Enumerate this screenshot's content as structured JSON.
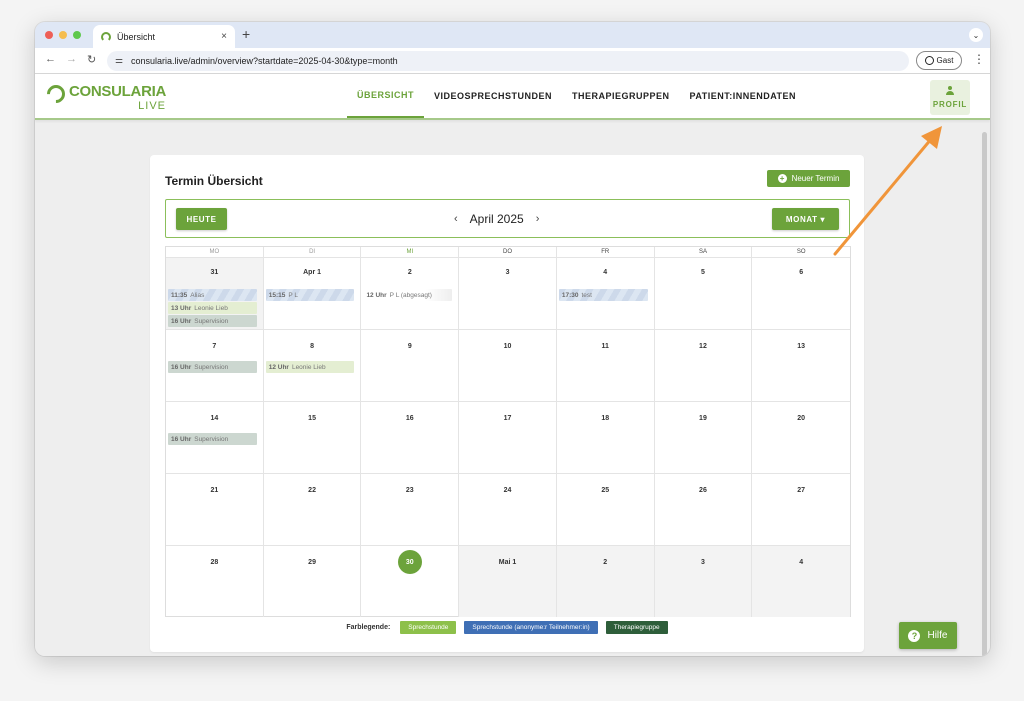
{
  "browser": {
    "tab_title": "Übersicht",
    "close_glyph": "×",
    "newtab_glyph": "+",
    "url": "consularia.live/admin/overview?startdate=2025-04-30&type=month",
    "profile_label": "Gast",
    "back_glyph": "←",
    "forward_glyph": "→",
    "reload_glyph": "↻",
    "menu_glyph": "⋮",
    "chevron_glyph": "⌄",
    "tune_glyph": "⚌"
  },
  "header": {
    "logo_word": "CONSULARIA",
    "logo_sub": "LIVE",
    "menu": [
      {
        "label": "ÜBERSICHT"
      },
      {
        "label": "VIDEOSPRECHSTUNDEN"
      },
      {
        "label": "THERAPIEGRUPPEN"
      },
      {
        "label": "PATIENT:INNENDATEN"
      }
    ],
    "profile_label": "PROFIL"
  },
  "card": {
    "title": "Termin Übersicht",
    "new_button": "Neuer Termin",
    "plus_glyph": "+",
    "today_button": "HEUTE",
    "month_title": "April 2025",
    "view_button": "MONAT  ▾",
    "prev_glyph": "‹",
    "next_glyph": "›"
  },
  "calendar": {
    "weekdays": [
      "MO",
      "DI",
      "MI",
      "DO",
      "FR",
      "SA",
      "SO"
    ],
    "weeks": [
      [
        {
          "num": "31",
          "events": [
            {
              "time": "11:35",
              "text": "Alias",
              "style": "blue"
            },
            {
              "time": "13 Uhr",
              "text": "Leonie Lieb",
              "style": "green"
            },
            {
              "time": "16 Uhr",
              "text": "Supervision",
              "style": "dark"
            }
          ]
        },
        {
          "num": "Apr 1",
          "events": [
            {
              "time": "15:15",
              "text": "P L",
              "style": "blue"
            }
          ]
        },
        {
          "num": "2",
          "events": [
            {
              "time": "12 Uhr",
              "text": "P L (abgesagt)",
              "style": "plain"
            }
          ]
        },
        {
          "num": "3",
          "events": []
        },
        {
          "num": "4",
          "events": [
            {
              "time": "17:30",
              "text": "test",
              "style": "blue"
            }
          ]
        },
        {
          "num": "5",
          "events": []
        },
        {
          "num": "6",
          "events": []
        }
      ],
      [
        {
          "num": "7",
          "events": [
            {
              "time": "16 Uhr",
              "text": "Supervision",
              "style": "dark"
            }
          ]
        },
        {
          "num": "8",
          "events": [
            {
              "time": "12 Uhr",
              "text": "Leonie Lieb",
              "style": "green"
            }
          ]
        },
        {
          "num": "9",
          "events": []
        },
        {
          "num": "10",
          "events": []
        },
        {
          "num": "11",
          "events": []
        },
        {
          "num": "12",
          "events": []
        },
        {
          "num": "13",
          "events": []
        }
      ],
      [
        {
          "num": "14",
          "events": [
            {
              "time": "16 Uhr",
              "text": "Supervision",
              "style": "dark"
            }
          ]
        },
        {
          "num": "15",
          "events": []
        },
        {
          "num": "16",
          "events": []
        },
        {
          "num": "17",
          "events": []
        },
        {
          "num": "18",
          "events": []
        },
        {
          "num": "19",
          "events": []
        },
        {
          "num": "20",
          "events": []
        }
      ],
      [
        {
          "num": "21",
          "events": []
        },
        {
          "num": "22",
          "events": []
        },
        {
          "num": "23",
          "events": []
        },
        {
          "num": "24",
          "events": []
        },
        {
          "num": "25",
          "events": []
        },
        {
          "num": "26",
          "events": []
        },
        {
          "num": "27",
          "events": []
        }
      ],
      [
        {
          "num": "28",
          "events": []
        },
        {
          "num": "29",
          "events": []
        },
        {
          "num": "30",
          "events": [],
          "today": true
        },
        {
          "num": "Mai 1",
          "events": [],
          "other": true
        },
        {
          "num": "2",
          "events": [],
          "other": true
        },
        {
          "num": "3",
          "events": [],
          "other": true
        },
        {
          "num": "4",
          "events": [],
          "other": true
        }
      ]
    ]
  },
  "legend": {
    "label": "Farblegende:",
    "items": [
      {
        "label": "Sprechstunde",
        "color": "#8dc04a"
      },
      {
        "label": "Sprechstunde (anonyme:r Teilnehmer:in)",
        "color": "#3f6fb5"
      },
      {
        "label": "Therapiegruppe",
        "color": "#2e5e3a"
      }
    ]
  },
  "help": {
    "label": "Hilfe",
    "glyph": "?"
  },
  "colors": {
    "brand_green": "#6ca33b",
    "annotation_arrow": "#f0953a"
  }
}
